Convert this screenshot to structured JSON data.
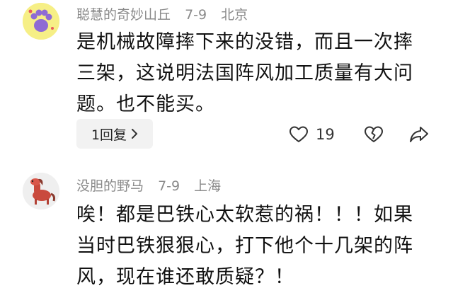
{
  "comments": [
    {
      "username": "聪慧的奇妙山丘",
      "date": "7-9",
      "location": "北京",
      "lines": [
        "是机械故障摔下来的没错，而且一次摔",
        "三架，这说明法国阵风加工质量有大问",
        "题。也不能买。"
      ],
      "reply_label": "1回复",
      "like_count": "19",
      "icons": {
        "like": "heart-outline-icon",
        "dislike": "broken-heart-icon",
        "share": "share-icon",
        "reply_chevron": "chevron-right-icon"
      }
    },
    {
      "username": "没胆的野马",
      "date": "7-9",
      "location": "上海",
      "lines": [
        "唉！都是巴铁心太软惹的祸！！！如果",
        "当时巴铁狠狠心，打下他个十几架的阵",
        "风，现在谁还敢质疑？！"
      ]
    }
  ],
  "colors": {
    "meta_text": "#8a8a8a",
    "reply_bg": "#f2f2f2",
    "avatar1_bg": "#f6ef86"
  }
}
